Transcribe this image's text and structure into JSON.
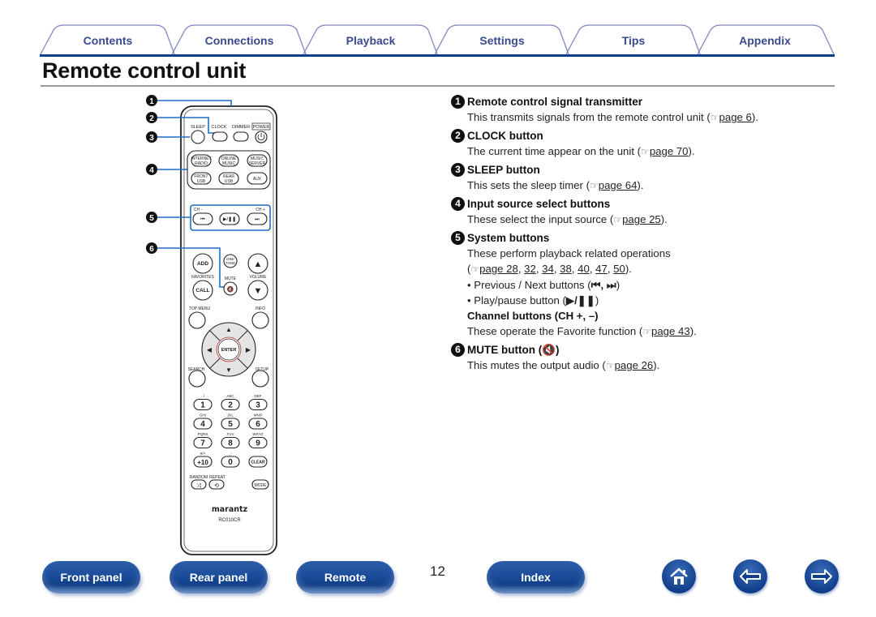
{
  "tabs": [
    {
      "label": "Contents"
    },
    {
      "label": "Connections"
    },
    {
      "label": "Playback"
    },
    {
      "label": "Settings"
    },
    {
      "label": "Tips"
    },
    {
      "label": "Appendix"
    }
  ],
  "page_title": "Remote control unit",
  "remote": {
    "callouts": [
      "1",
      "2",
      "3",
      "4",
      "5",
      "6"
    ],
    "top_labels": {
      "sleep": "SLEEP",
      "clock": "CLOCK",
      "dimmer": "DIMMER",
      "power": "POWER"
    },
    "source_buttons": [
      [
        "INTERNET",
        "RADIO"
      ],
      [
        "ONLINE",
        "MUSIC"
      ],
      [
        "MUSIC",
        "SERVER"
      ],
      [
        "FRONT",
        "USB"
      ],
      [
        "REAR",
        "USB"
      ],
      [
        "AUX"
      ]
    ],
    "ch_minus": "CH -",
    "ch_plus": "CH +",
    "add": "ADD",
    "dimmer_tone": [
      "DIM/",
      "TONE"
    ],
    "favorites": "FAVORITES",
    "mute": "MUTE",
    "volume": "VOLUME",
    "call": "CALL",
    "top_menu": "TOP MENU",
    "info": "INFO",
    "enter": "ENTER",
    "search": "SEARCH",
    "setup": "SETUP",
    "keypad": [
      {
        "sub": ". /",
        "key": "1"
      },
      {
        "sub": "ABC",
        "key": "2"
      },
      {
        "sub": "DEF",
        "key": "3"
      },
      {
        "sub": "GHI",
        "key": "4"
      },
      {
        "sub": "JKL",
        "key": "5"
      },
      {
        "sub": "MNO",
        "key": "6"
      },
      {
        "sub": "PQRS",
        "key": "7"
      },
      {
        "sub": "TUV",
        "key": "8"
      },
      {
        "sub": "WXYZ",
        "key": "9"
      },
      {
        "sub": "a/A",
        "key": "+10"
      },
      {
        "sub": "_-",
        "key": "0"
      },
      {
        "sub": "",
        "key": "CLEAR"
      }
    ],
    "random": "RANDOM",
    "repeat": "REPEAT",
    "mode": "MODE",
    "brand": "marantz",
    "model": "RC010CR"
  },
  "items": [
    {
      "num": "1",
      "title": "Remote control signal transmitter",
      "text": "This transmits signals from the remote control unit (",
      "ref": "page 6",
      "tail": ")."
    },
    {
      "num": "2",
      "title": "CLOCK button",
      "text": "The current time appear on the unit (",
      "ref": "page 70",
      "tail": ")."
    },
    {
      "num": "3",
      "title": "SLEEP button",
      "text": "This sets the sleep timer (",
      "ref": "page 64",
      "tail": ")."
    },
    {
      "num": "4",
      "title": "Input source select buttons",
      "text": "These select the input source (",
      "ref": "page 25",
      "tail": ")."
    },
    {
      "num": "5",
      "title": "System buttons",
      "text": "These perform playback related operations",
      "refs": [
        "page 28",
        "32",
        "34",
        "38",
        "40",
        "47",
        "50"
      ],
      "bullets": [
        "• Previous / Next buttons (",
        "• Play/pause button ("
      ],
      "bullet_sym": [
        "⏮, ⏭",
        "▶/❚❚"
      ],
      "sub_title": "Channel buttons (CH +, –)",
      "sub_text": "These operate the Favorite function (",
      "sub_ref": "page 43",
      "sub_tail": ")."
    },
    {
      "num": "6",
      "title": "MUTE button (🔇)",
      "text": "This mutes the output audio (",
      "ref": "page 26",
      "tail": ")."
    }
  ],
  "footer": {
    "front_panel": "Front panel",
    "rear_panel": "Rear panel",
    "remote": "Remote",
    "page_number": "12",
    "index": "Index"
  },
  "colors": {
    "accent": "#0c3d8f",
    "tab_text": "#3a4a8f",
    "callout_line": "#1f6fc4"
  }
}
